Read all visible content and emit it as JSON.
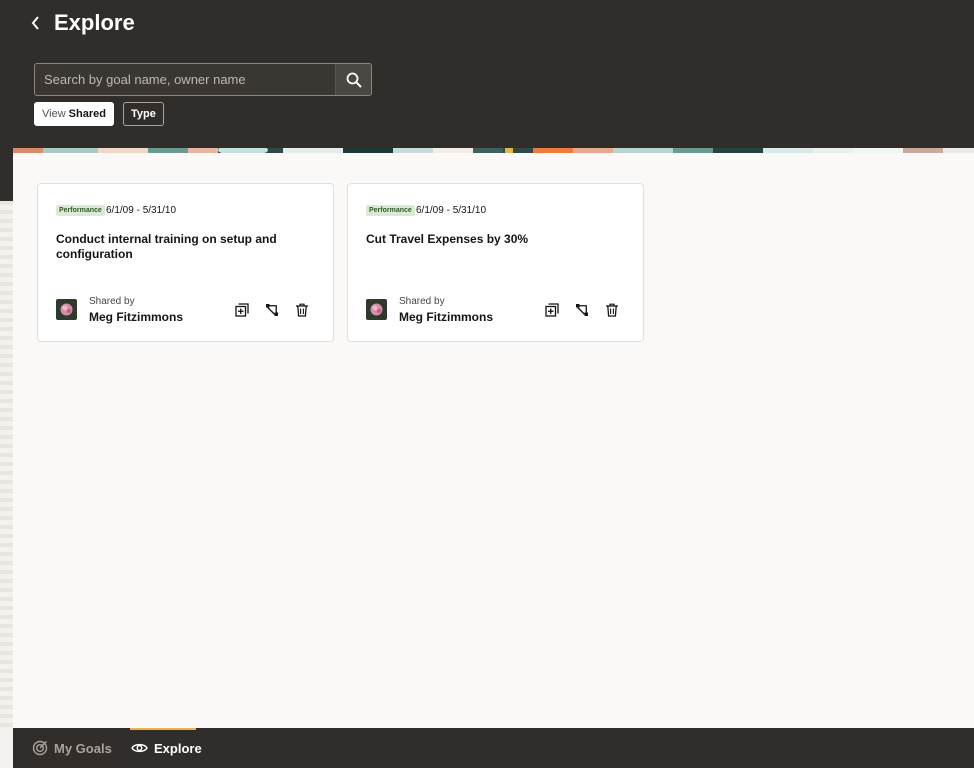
{
  "header": {
    "title": "Explore",
    "search": {
      "placeholder": "Search by goal name, owner name",
      "value": ""
    },
    "filters": {
      "view": {
        "prefix": "View",
        "value": "Shared"
      },
      "type": {
        "label": "Type"
      }
    }
  },
  "cards": [
    {
      "badge": "Performance",
      "dates": "6/1/09 - 5/31/10",
      "title": "Conduct internal training on setup and configuration",
      "shared_label": "Shared by",
      "owner": "Meg Fitzimmons"
    },
    {
      "badge": "Performance",
      "dates": "6/1/09 - 5/31/10",
      "title": "Cut Travel Expenses by 30%",
      "shared_label": "Shared by",
      "owner": "Meg Fitzimmons"
    }
  ],
  "bottom_nav": {
    "items": [
      {
        "label": "My Goals",
        "icon": "target-icon",
        "active": false
      },
      {
        "label": "Explore",
        "icon": "eye-icon",
        "active": true
      }
    ]
  },
  "colors": {
    "header_bg": "#312d2a",
    "active_tab_accent": "#e9b44c",
    "badge_bg": "#d9ecd3"
  }
}
